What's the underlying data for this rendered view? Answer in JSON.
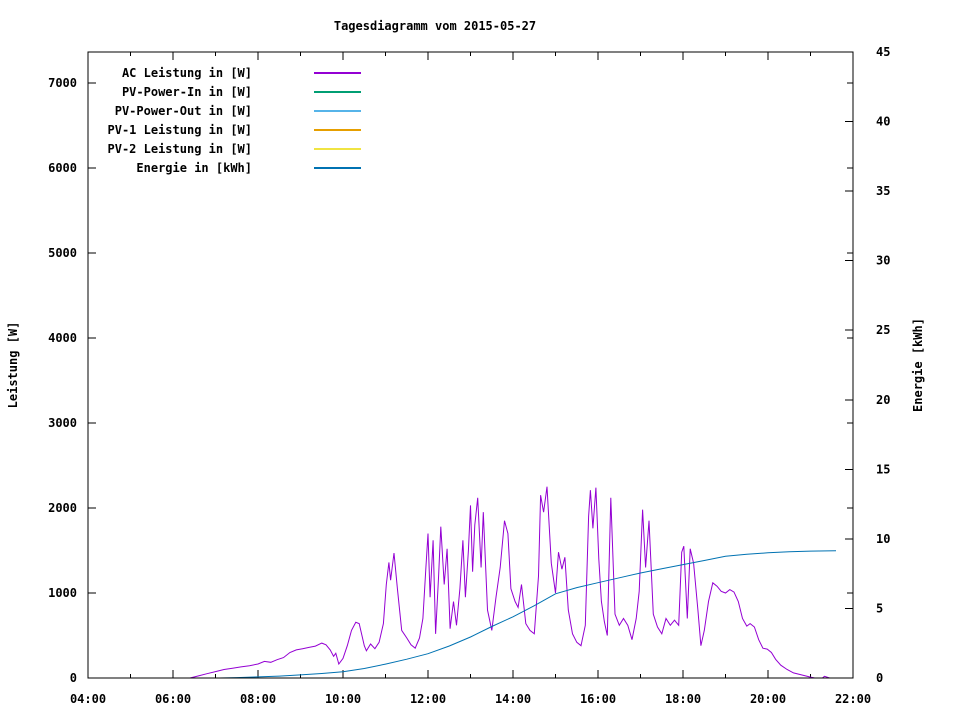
{
  "page": {
    "background": "#ffffff",
    "foreground": "#000000"
  },
  "chart_data": {
    "type": "line",
    "title": "Tagesdiagramm vom 2015-05-27",
    "xlabel": "",
    "ylabel": "Leistung [W]",
    "y2label": "Energie [kWh]",
    "grid": false,
    "legend_position": "top-left-inside",
    "xlim": [
      4,
      22
    ],
    "ylim": [
      0,
      7364
    ],
    "y2lim": [
      0,
      45
    ],
    "x_major_ticks": [
      {
        "value": 4,
        "label": "04:00"
      },
      {
        "value": 6,
        "label": "06:00"
      },
      {
        "value": 8,
        "label": "08:00"
      },
      {
        "value": 10,
        "label": "10:00"
      },
      {
        "value": 12,
        "label": "12:00"
      },
      {
        "value": 14,
        "label": "14:00"
      },
      {
        "value": 16,
        "label": "16:00"
      },
      {
        "value": 18,
        "label": "18:00"
      },
      {
        "value": 20,
        "label": "20:00"
      },
      {
        "value": 22,
        "label": "22:00"
      }
    ],
    "x_minor_tick_values": [
      5,
      7,
      9,
      11,
      13,
      15,
      17,
      19,
      21
    ],
    "y_ticks": [
      {
        "value": 0,
        "label": "0"
      },
      {
        "value": 1000,
        "label": "1000"
      },
      {
        "value": 2000,
        "label": "2000"
      },
      {
        "value": 3000,
        "label": "3000"
      },
      {
        "value": 4000,
        "label": "4000"
      },
      {
        "value": 5000,
        "label": "5000"
      },
      {
        "value": 6000,
        "label": "6000"
      },
      {
        "value": 7000,
        "label": "7000"
      }
    ],
    "y2_ticks": [
      {
        "value": 0,
        "label": "0"
      },
      {
        "value": 5,
        "label": "5"
      },
      {
        "value": 10,
        "label": "10"
      },
      {
        "value": 15,
        "label": "15"
      },
      {
        "value": 20,
        "label": "20"
      },
      {
        "value": 25,
        "label": "25"
      },
      {
        "value": 30,
        "label": "30"
      },
      {
        "value": 35,
        "label": "35"
      },
      {
        "value": 40,
        "label": "40"
      },
      {
        "value": 45,
        "label": "45"
      }
    ],
    "series": [
      {
        "name": "AC Leistung in [W]",
        "color": "#9400d3",
        "axis": "y",
        "points": [
          [
            6.17,
            0
          ],
          [
            6.4,
            0
          ],
          [
            6.6,
            25
          ],
          [
            6.8,
            50
          ],
          [
            7.0,
            75
          ],
          [
            7.2,
            100
          ],
          [
            7.4,
            115
          ],
          [
            7.6,
            130
          ],
          [
            7.8,
            145
          ],
          [
            8.0,
            165
          ],
          [
            8.15,
            195
          ],
          [
            8.3,
            185
          ],
          [
            8.45,
            215
          ],
          [
            8.6,
            240
          ],
          [
            8.75,
            300
          ],
          [
            8.9,
            330
          ],
          [
            9.05,
            345
          ],
          [
            9.2,
            360
          ],
          [
            9.35,
            375
          ],
          [
            9.5,
            410
          ],
          [
            9.6,
            390
          ],
          [
            9.7,
            330
          ],
          [
            9.78,
            255
          ],
          [
            9.83,
            290
          ],
          [
            9.9,
            165
          ],
          [
            10.0,
            230
          ],
          [
            10.1,
            380
          ],
          [
            10.2,
            560
          ],
          [
            10.3,
            655
          ],
          [
            10.38,
            640
          ],
          [
            10.5,
            380
          ],
          [
            10.55,
            320
          ],
          [
            10.65,
            400
          ],
          [
            10.75,
            345
          ],
          [
            10.85,
            420
          ],
          [
            10.95,
            640
          ],
          [
            11.02,
            1100
          ],
          [
            11.08,
            1360
          ],
          [
            11.12,
            1150
          ],
          [
            11.2,
            1470
          ],
          [
            11.28,
            1050
          ],
          [
            11.38,
            560
          ],
          [
            11.5,
            470
          ],
          [
            11.6,
            390
          ],
          [
            11.7,
            350
          ],
          [
            11.8,
            470
          ],
          [
            11.88,
            700
          ],
          [
            11.95,
            1300
          ],
          [
            12.0,
            1700
          ],
          [
            12.05,
            950
          ],
          [
            12.12,
            1620
          ],
          [
            12.18,
            520
          ],
          [
            12.25,
            1200
          ],
          [
            12.3,
            1780
          ],
          [
            12.38,
            1100
          ],
          [
            12.45,
            1520
          ],
          [
            12.52,
            580
          ],
          [
            12.6,
            900
          ],
          [
            12.67,
            620
          ],
          [
            12.75,
            1050
          ],
          [
            12.82,
            1620
          ],
          [
            12.88,
            950
          ],
          [
            12.95,
            1500
          ],
          [
            13.0,
            2030
          ],
          [
            13.05,
            1250
          ],
          [
            13.1,
            1800
          ],
          [
            13.17,
            2120
          ],
          [
            13.25,
            1300
          ],
          [
            13.3,
            1950
          ],
          [
            13.4,
            800
          ],
          [
            13.5,
            560
          ],
          [
            13.6,
            950
          ],
          [
            13.7,
            1300
          ],
          [
            13.8,
            1850
          ],
          [
            13.88,
            1700
          ],
          [
            13.95,
            1050
          ],
          [
            14.05,
            900
          ],
          [
            14.12,
            830
          ],
          [
            14.2,
            1100
          ],
          [
            14.3,
            640
          ],
          [
            14.4,
            560
          ],
          [
            14.5,
            520
          ],
          [
            14.6,
            1200
          ],
          [
            14.65,
            2150
          ],
          [
            14.72,
            1950
          ],
          [
            14.8,
            2250
          ],
          [
            14.9,
            1350
          ],
          [
            15.0,
            1000
          ],
          [
            15.07,
            1480
          ],
          [
            15.15,
            1280
          ],
          [
            15.22,
            1420
          ],
          [
            15.3,
            800
          ],
          [
            15.4,
            520
          ],
          [
            15.5,
            420
          ],
          [
            15.6,
            380
          ],
          [
            15.7,
            620
          ],
          [
            15.78,
            1900
          ],
          [
            15.82,
            2210
          ],
          [
            15.88,
            1760
          ],
          [
            15.95,
            2240
          ],
          [
            16.02,
            1400
          ],
          [
            16.08,
            900
          ],
          [
            16.15,
            660
          ],
          [
            16.22,
            500
          ],
          [
            16.3,
            2120
          ],
          [
            16.4,
            750
          ],
          [
            16.5,
            620
          ],
          [
            16.6,
            700
          ],
          [
            16.7,
            620
          ],
          [
            16.8,
            450
          ],
          [
            16.9,
            700
          ],
          [
            16.97,
            1020
          ],
          [
            17.05,
            1980
          ],
          [
            17.12,
            1300
          ],
          [
            17.2,
            1850
          ],
          [
            17.3,
            750
          ],
          [
            17.4,
            600
          ],
          [
            17.5,
            520
          ],
          [
            17.6,
            700
          ],
          [
            17.7,
            620
          ],
          [
            17.8,
            680
          ],
          [
            17.9,
            620
          ],
          [
            17.97,
            1480
          ],
          [
            18.02,
            1550
          ],
          [
            18.1,
            700
          ],
          [
            18.17,
            1520
          ],
          [
            18.25,
            1350
          ],
          [
            18.35,
            800
          ],
          [
            18.42,
            380
          ],
          [
            18.5,
            560
          ],
          [
            18.6,
            900
          ],
          [
            18.7,
            1120
          ],
          [
            18.8,
            1080
          ],
          [
            18.9,
            1020
          ],
          [
            19.0,
            1000
          ],
          [
            19.1,
            1040
          ],
          [
            19.2,
            1010
          ],
          [
            19.3,
            900
          ],
          [
            19.4,
            700
          ],
          [
            19.5,
            610
          ],
          [
            19.58,
            640
          ],
          [
            19.68,
            600
          ],
          [
            19.78,
            450
          ],
          [
            19.88,
            350
          ],
          [
            19.98,
            340
          ],
          [
            20.08,
            300
          ],
          [
            20.18,
            220
          ],
          [
            20.3,
            150
          ],
          [
            20.45,
            100
          ],
          [
            20.6,
            60
          ],
          [
            20.8,
            35
          ],
          [
            21.0,
            10
          ],
          [
            21.1,
            0
          ],
          [
            21.28,
            0
          ],
          [
            21.33,
            20
          ],
          [
            21.45,
            0
          ]
        ]
      },
      {
        "name": "PV-Power-In in [W]",
        "color": "#009e73",
        "axis": "y",
        "points": []
      },
      {
        "name": "PV-Power-Out in [W]",
        "color": "#56b4e9",
        "axis": "y",
        "points": []
      },
      {
        "name": "PV-1 Leistung in [W]",
        "color": "#e69f00",
        "axis": "y",
        "points": []
      },
      {
        "name": "PV-2 Leistung in [W]",
        "color": "#f0e442",
        "axis": "y",
        "points": []
      },
      {
        "name": "Energie in [kWh]",
        "color": "#0072b2",
        "axis": "y2",
        "points": [
          [
            7.1,
            0
          ],
          [
            7.5,
            0.03
          ],
          [
            8.0,
            0.08
          ],
          [
            8.5,
            0.14
          ],
          [
            9.0,
            0.22
          ],
          [
            9.5,
            0.32
          ],
          [
            10.0,
            0.45
          ],
          [
            10.5,
            0.68
          ],
          [
            11.0,
            1.0
          ],
          [
            11.5,
            1.35
          ],
          [
            12.0,
            1.75
          ],
          [
            12.5,
            2.3
          ],
          [
            13.0,
            2.95
          ],
          [
            13.5,
            3.7
          ],
          [
            14.0,
            4.4
          ],
          [
            14.5,
            5.2
          ],
          [
            15.0,
            6.05
          ],
          [
            15.5,
            6.5
          ],
          [
            16.0,
            6.85
          ],
          [
            16.5,
            7.2
          ],
          [
            17.0,
            7.55
          ],
          [
            17.5,
            7.85
          ],
          [
            18.0,
            8.15
          ],
          [
            18.5,
            8.45
          ],
          [
            19.0,
            8.75
          ],
          [
            19.5,
            8.9
          ],
          [
            20.0,
            9.0
          ],
          [
            20.5,
            9.07
          ],
          [
            21.0,
            9.12
          ],
          [
            21.6,
            9.15
          ]
        ]
      }
    ]
  }
}
